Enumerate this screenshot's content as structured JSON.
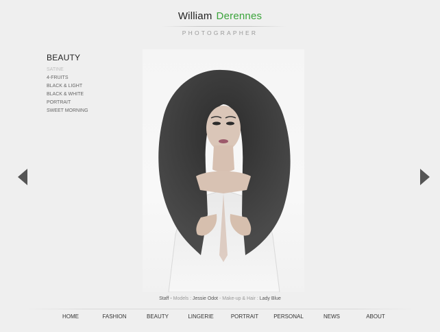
{
  "header": {
    "first_name": "William",
    "last_name": "Derennes",
    "tagline": "PHOTOGRAPHER",
    "accent_color": "#3aa33a"
  },
  "gallery": {
    "title": "BEAUTY",
    "items": [
      {
        "label": "SATINE",
        "active": true
      },
      {
        "label": "4-FRUITS",
        "active": false
      },
      {
        "label": "BLACK & LIGHT",
        "active": false
      },
      {
        "label": "BLACK & WHITE",
        "active": false
      },
      {
        "label": "PORTRAIT",
        "active": false
      },
      {
        "label": "SWEET MORNING",
        "active": false
      }
    ]
  },
  "arrows": {
    "prev_icon": "arrow-left-icon",
    "next_icon": "arrow-right-icon"
  },
  "credits": {
    "staff_label": "Staff -",
    "models_label": "Models :",
    "model_name": "Jessie Odot",
    "separator": "-",
    "makeup_label": "Make-up & Hair :",
    "makeup_name": "Lady Blue"
  },
  "nav": {
    "items": [
      {
        "label": "HOME"
      },
      {
        "label": "FASHION"
      },
      {
        "label": "BEAUTY"
      },
      {
        "label": "LINGERIE"
      },
      {
        "label": "PORTRAIT"
      },
      {
        "label": "PERSONAL"
      },
      {
        "label": "NEWS"
      },
      {
        "label": "ABOUT"
      }
    ]
  }
}
